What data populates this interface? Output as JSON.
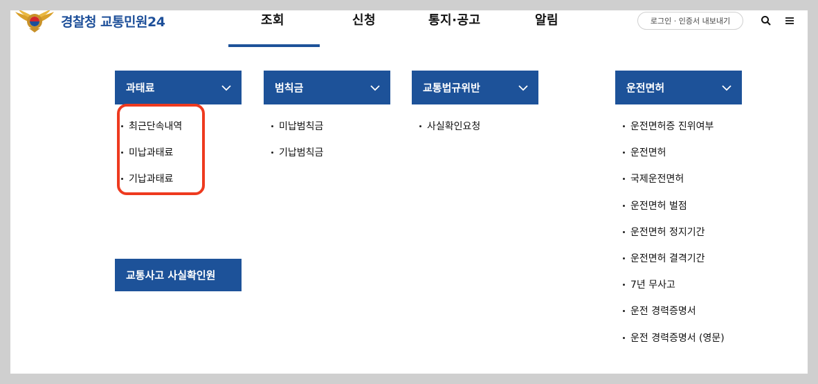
{
  "header": {
    "logo_text": "경찰청 교통민원24",
    "nav": [
      "조회",
      "신청",
      "통지·공고",
      "알림"
    ],
    "login_label": "로그인 · 인증서 내보내기"
  },
  "menus": [
    {
      "title": "과태료",
      "items": [
        "최근단속내역",
        "미납과태료",
        "기납과태료"
      ]
    },
    {
      "title": "범칙금",
      "items": [
        "미납범칙금",
        "기납범칙금"
      ]
    },
    {
      "title": "교통법규위반",
      "items": [
        "사실확인요청"
      ]
    },
    {
      "title": "운전면허",
      "items": [
        "운전면허증 진위여부",
        "운전면허",
        "국제운전면허",
        "운전면허 벌점",
        "운전면허 정지기간",
        "운전면허 결격기간",
        "7년 무사고",
        "운전 경력증명서",
        "운전 경력증명서 (영문)"
      ]
    }
  ],
  "accident": {
    "title": "교통사고 사실확인원"
  },
  "colors": {
    "primary": "#1d5299",
    "highlight": "#ee3a1f",
    "logo_text": "#1d4f99"
  }
}
